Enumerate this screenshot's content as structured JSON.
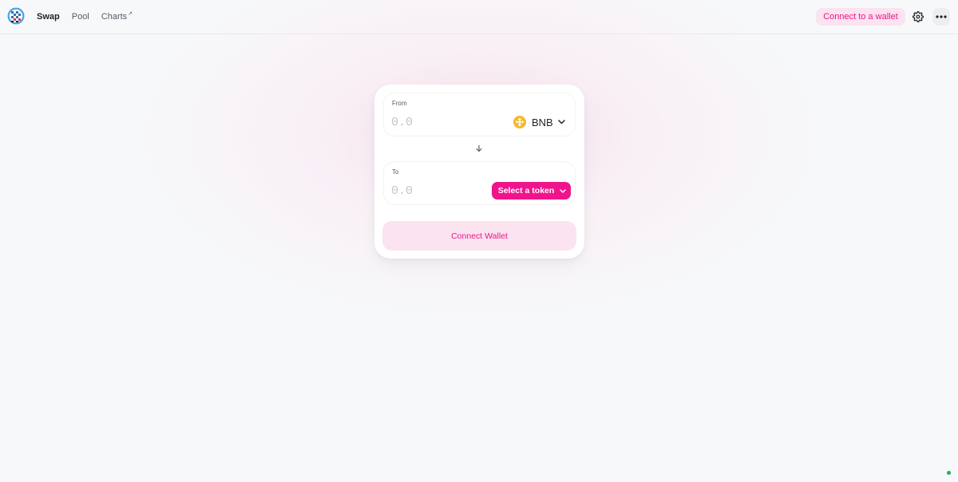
{
  "header": {
    "nav": [
      {
        "label": "Swap",
        "active": true
      },
      {
        "label": "Pool",
        "active": false
      },
      {
        "label": "Charts",
        "active": false,
        "external": true
      }
    ],
    "connect_label": "Connect to a wallet",
    "settings_icon": "gear-icon",
    "more_icon": "more-dots-icon"
  },
  "swap": {
    "from": {
      "label": "From",
      "placeholder": "0.0",
      "token_symbol": "BNB",
      "token_icon": "bnb-token-icon"
    },
    "to": {
      "label": "To",
      "placeholder": "0.0",
      "select_label": "Select a token"
    },
    "connect_wallet_label": "Connect Wallet"
  },
  "colors": {
    "accent": "#f0148c",
    "accent_soft": "#fbe3ef",
    "bnb": "#f3ba2f",
    "background": "#f7f8fa"
  }
}
